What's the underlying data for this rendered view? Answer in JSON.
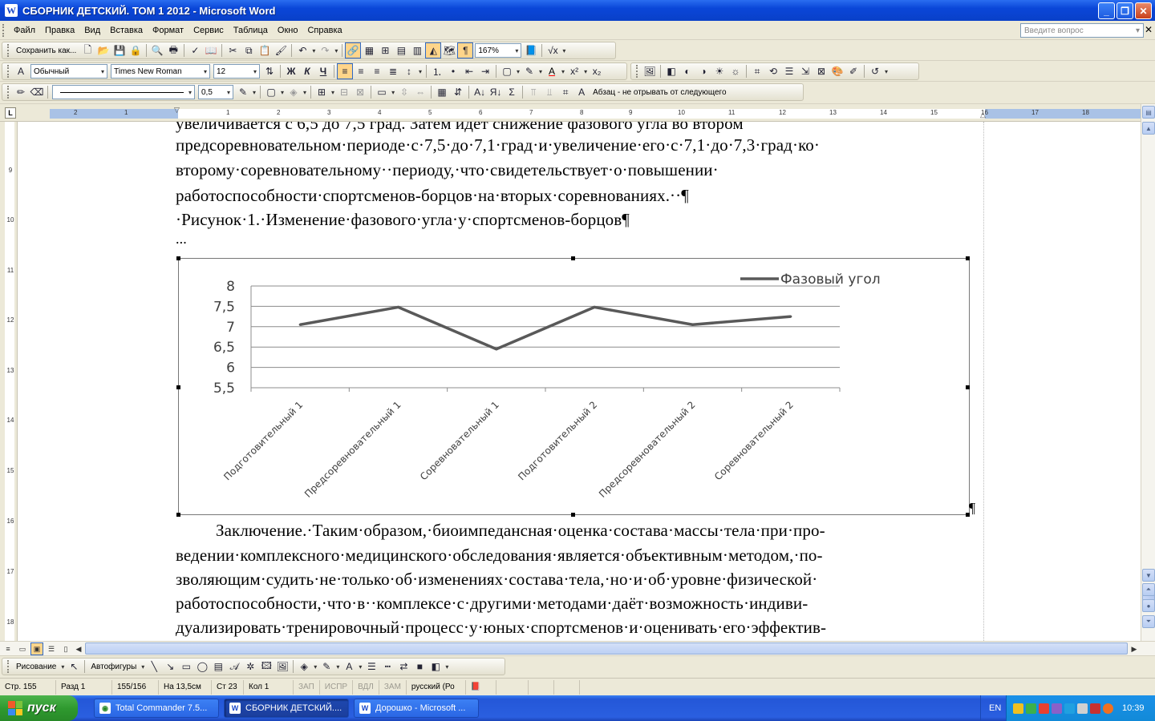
{
  "window": {
    "title": "СБОРНИК ДЕТСКИЙ. ТОМ 1 2012 - Microsoft Word",
    "app_icon": "W"
  },
  "menu": {
    "items": [
      "Файл",
      "Правка",
      "Вид",
      "Вставка",
      "Формат",
      "Сервис",
      "Таблица",
      "Окно",
      "Справка"
    ],
    "ask_placeholder": "Введите вопрос"
  },
  "toolbar1": {
    "save_as_label": "Сохранить как...",
    "zoom": "167%"
  },
  "toolbar2": {
    "style": "Обычный",
    "font": "Times New Roman",
    "size": "12"
  },
  "toolbar3": {
    "line_weight": "0,5",
    "para_style": "Абзац - не отрывать от следующего"
  },
  "ruler": {
    "h_ticks": [
      "2",
      "1",
      "1",
      "2",
      "3",
      "4",
      "5",
      "6",
      "7",
      "8",
      "9",
      "10",
      "11",
      "12",
      "13",
      "14",
      "15",
      "16",
      "17",
      "18"
    ],
    "v_ticks": [
      "9",
      "10",
      "11",
      "12",
      "13",
      "14",
      "15",
      "16",
      "17",
      "18"
    ]
  },
  "document": {
    "lines": [
      "увеличивается с 6,5 до 7,5 град. Затем идет снижение фазового угла во втором",
      "предсоревновательном·периоде·с·7,5·до·7,1·град·и·увеличение·его·с·7,1·до·7,3·град·ко·",
      "второму·соревновательному··периоду,·что·свидетельствует·о·повышении·",
      "работоспособности·спортсменов-борцов·на·вторых·соревнованиях.··¶",
      "·Рисунок·1.·Изменение·фазового·угла·у·спортсменов-борцов¶",
      "..."
    ],
    "after_chart_mark": "¶",
    "conclusion": [
      "Заключение.·Таким·образом,·биоимпедансная·оценка·состава·массы·тела·при·про-",
      "ведении·комплексного·медицинского·обследования·является·объективным·методом,·по-",
      "зволяющим·судить·не·только·об·изменениях·состава·тела,·но·и·об·уровне·физической·",
      "работоспособности,·что·в··комплексе·с·другими·методами·даёт·возможность·индиви-",
      "дуализировать·тренировочный·процесс·у·юных·спортсменов·и·оценивать·его·эффектив-"
    ]
  },
  "chart_data": {
    "type": "line",
    "categories": [
      "Подготовительный 1",
      "Предсоревновательный 1",
      "Соревновательный 1",
      "Подготовительный 2",
      "Предсоревновательный 2",
      "Соревновательный 2"
    ],
    "series": [
      {
        "name": "Фазовый угол",
        "values": [
          7.05,
          7.48,
          6.45,
          7.48,
          7.05,
          7.25
        ],
        "color": "#595959"
      }
    ],
    "y_ticks": [
      "8",
      "7,5",
      "7",
      "6,5",
      "6",
      "5,5"
    ],
    "ylim": [
      5.5,
      8
    ],
    "grid": true,
    "legend_position": "top-right"
  },
  "drawbar": {
    "drawing_label": "Рисование",
    "autoshapes_label": "Автофигуры"
  },
  "status": {
    "page": "Стр.  155",
    "section": "Разд  1",
    "pages": "155/156",
    "at": "На  13,5см",
    "line": "Ст  23",
    "col": "Кол  1",
    "rec": "ЗАП",
    "trk": "ИСПР",
    "ext": "ВДЛ",
    "ovr": "ЗАМ",
    "lang": "русский (Ро"
  },
  "taskbar": {
    "start_label": "пуск",
    "tasks": [
      "Total Commander 7.5...",
      "СБОРНИК ДЕТСКИЙ....",
      "Дорошко - Microsoft ..."
    ],
    "lang": "EN",
    "clock": "10:39"
  }
}
